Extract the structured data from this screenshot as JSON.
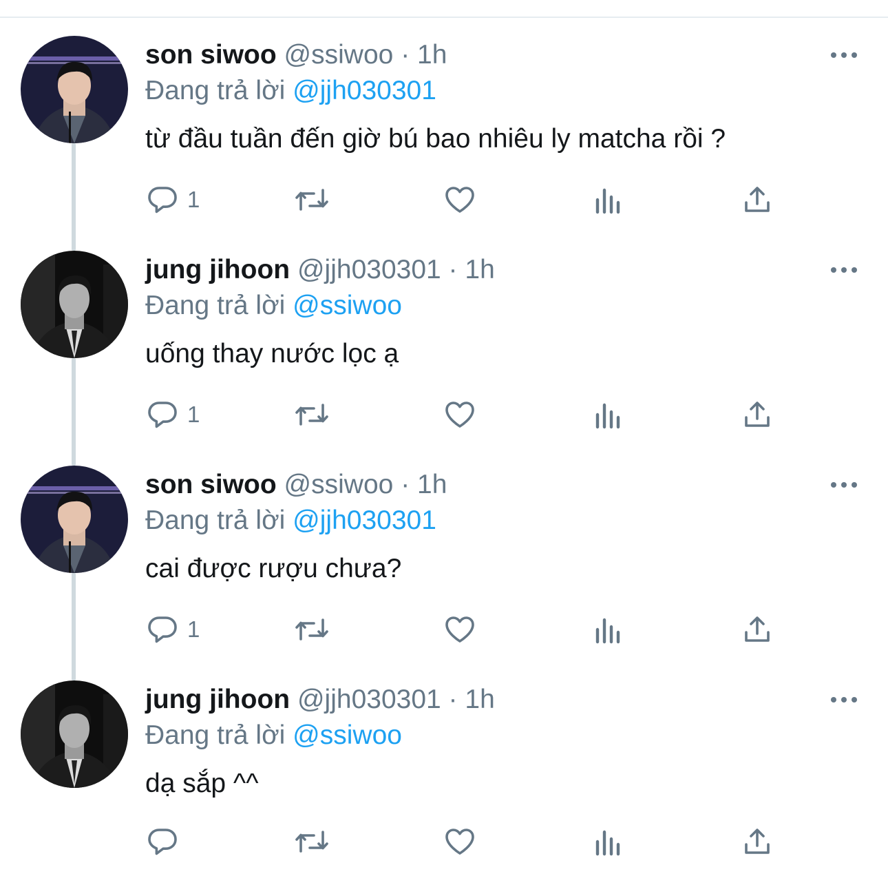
{
  "thread": {
    "tweets": [
      {
        "display_name": "son siwoo",
        "handle": "@ssiwoo",
        "separator": "·",
        "time": "1h",
        "reply_prefix": "Đang trả lời",
        "reply_to": "@jjh030301",
        "text": "từ đầu tuần đến giờ bú bao nhiêu ly matcha rồi ?",
        "reply_count": "1",
        "avatar_icon": "avatar-son-siwoo"
      },
      {
        "display_name": "jung jihoon",
        "handle": "@jjh030301",
        "separator": "·",
        "time": "1h",
        "reply_prefix": "Đang trả lời",
        "reply_to": "@ssiwoo",
        "text": "uống thay nước lọc ạ",
        "reply_count": "1",
        "avatar_icon": "avatar-jung-jihoon"
      },
      {
        "display_name": "son siwoo",
        "handle": "@ssiwoo",
        "separator": "·",
        "time": "1h",
        "reply_prefix": "Đang trả lời",
        "reply_to": "@jjh030301",
        "text": "cai được rượu chưa?",
        "reply_count": "1",
        "avatar_icon": "avatar-son-siwoo"
      },
      {
        "display_name": "jung jihoon",
        "handle": "@jjh030301",
        "separator": "·",
        "time": "1h",
        "reply_prefix": "Đang trả lời",
        "reply_to": "@ssiwoo",
        "text": "dạ sắp ^^",
        "reply_count": "",
        "avatar_icon": "avatar-jung-jihoon"
      }
    ]
  },
  "icons": {
    "reply": "reply-icon",
    "retweet": "retweet-icon",
    "like": "heart-icon",
    "analytics": "analytics-icon",
    "share": "share-icon",
    "more": "more-icon"
  },
  "colors": {
    "text_primary": "#14171a",
    "text_secondary": "#657786",
    "link": "#1da1f2",
    "thread_line": "#cfd9de",
    "divider": "#e6ecf0"
  }
}
